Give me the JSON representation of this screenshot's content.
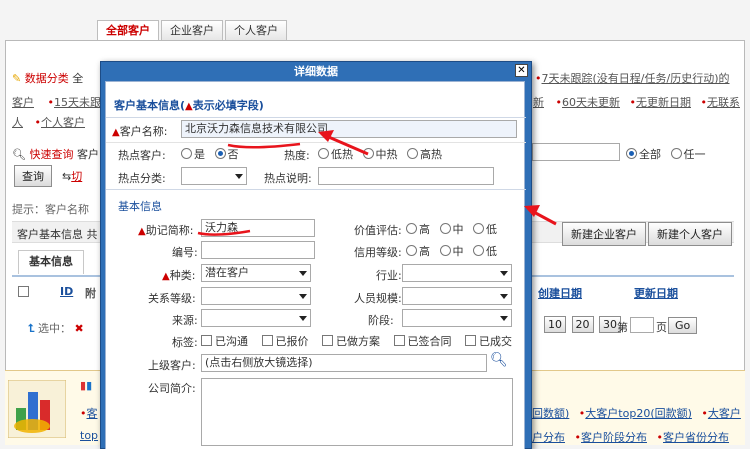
{
  "top_tabs": [
    "全部客户",
    "企业客户",
    "个人客户"
  ],
  "filter": {
    "category_label": "数据分类",
    "row1_prefix": "全",
    "row1_right": "7天未跟踪(没有日程/任务/历史行动)的",
    "row2_left": "客户",
    "row2_items": [
      "15天未跟",
      "新",
      "60天未更新",
      "无更新日期",
      "无联系"
    ],
    "row3_left": "人",
    "row3_item": "个人客户"
  },
  "search": {
    "quick_label": "快速查询",
    "quick_suffix": "客户",
    "query_button": "查询",
    "switch_label": "切",
    "radio_all": "全部",
    "radio_any": "任一"
  },
  "hint": "提示：客户名称",
  "section": {
    "title": "客户基本信息",
    "title_suffix": "共",
    "new_company": "新建企业客户",
    "new_person": "新建个人客户"
  },
  "subtab": "基本信息",
  "grid": {
    "col_id": "ID",
    "col_attach": "附",
    "col_created": "创建日期",
    "col_updated": "更新日期"
  },
  "pager": {
    "selected_label": "选中：",
    "sizes": [
      "10",
      "20",
      "30"
    ],
    "page_prefix": "第",
    "page_suffix": "页",
    "go": "Go"
  },
  "bottom": {
    "line1_items": [
      "客",
      "回数额)",
      "大客户top20(回款额)",
      "大客户"
    ],
    "line2_items": [
      "top",
      "户分布",
      "客户阶段分布",
      "客户省份分布"
    ]
  },
  "dialog": {
    "title": "详细数据",
    "close_glyph": "✕",
    "basic_header": "客户基本信息",
    "required_note": "表示必填字段",
    "customer_name_label": "客户名称:",
    "customer_name_value": "北京沃力森信息技术有限公司",
    "hot_customer_label": "热点客户:",
    "hot_yes": "是",
    "hot_no": "否",
    "hot_no_selected": true,
    "heat_label": "热度:",
    "heat_options": [
      "低热",
      "中热",
      "高热"
    ],
    "hot_category_label": "热点分类:",
    "hot_desc_label": "热点说明:",
    "basic_info_header": "基本信息",
    "alias_label": "助记简称:",
    "alias_value": "沃力森",
    "value_label": "价值评估:",
    "value_options": [
      "高",
      "中",
      "低"
    ],
    "number_label": "编号:",
    "credit_label": "信用等级:",
    "credit_options": [
      "高",
      "中",
      "低"
    ],
    "type_label": "种类:",
    "type_value": "潜在客户",
    "industry_label": "行业:",
    "relation_label": "关系等级:",
    "staff_label": "人员规模:",
    "source_label": "来源:",
    "stage_label": "阶段:",
    "tags_label": "标签:",
    "tags": [
      "已沟通",
      "已报价",
      "已做方案",
      "已签合同",
      "已成交"
    ],
    "parent_label": "上级客户:",
    "parent_placeholder": "(点击右侧放大镜选择)",
    "intro_label": "公司简介:"
  },
  "colors": {
    "dialog_blue": "#2f6fb6",
    "required_red": "#cc0000",
    "annotation_red": "#e8141c",
    "section_blue": "#1a4f9c"
  }
}
